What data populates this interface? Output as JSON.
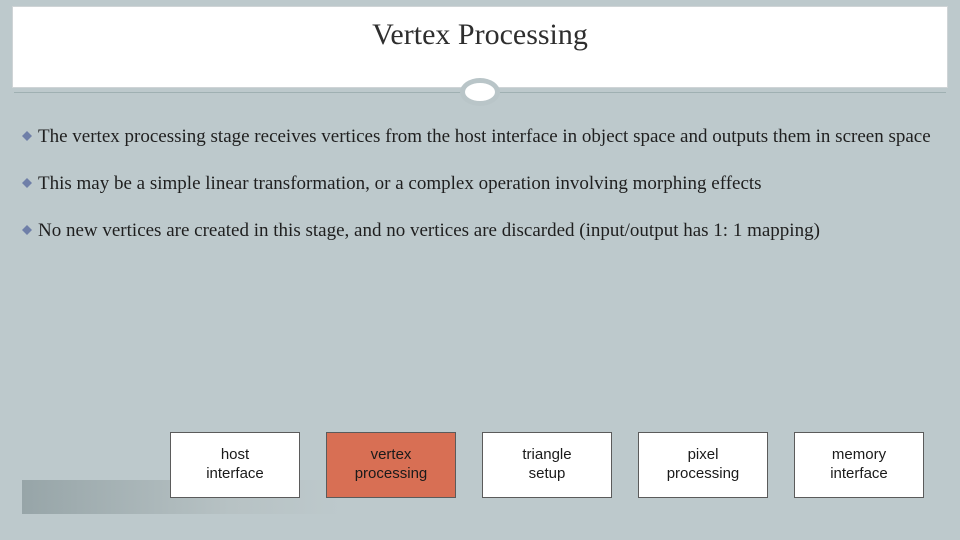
{
  "title": "Vertex Processing",
  "bullets": [
    "The vertex processing stage receives vertices from the host interface in object space and outputs them in screen space",
    "This may be a simple linear transformation, or a complex operation involving morphing effects",
    "No new vertices are created in this stage, and no vertices are discarded (input/output has 1: 1 mapping)"
  ],
  "pipeline": {
    "stages": [
      {
        "label": "host\ninterface",
        "highlight": false
      },
      {
        "label": "vertex\nprocessing",
        "highlight": true
      },
      {
        "label": "triangle\nsetup",
        "highlight": false
      },
      {
        "label": "pixel\nprocessing",
        "highlight": false
      },
      {
        "label": "memory\ninterface",
        "highlight": false
      }
    ]
  },
  "colors": {
    "bullet_diamond": "#6f7fa8",
    "highlight_box": "#d86f54"
  }
}
